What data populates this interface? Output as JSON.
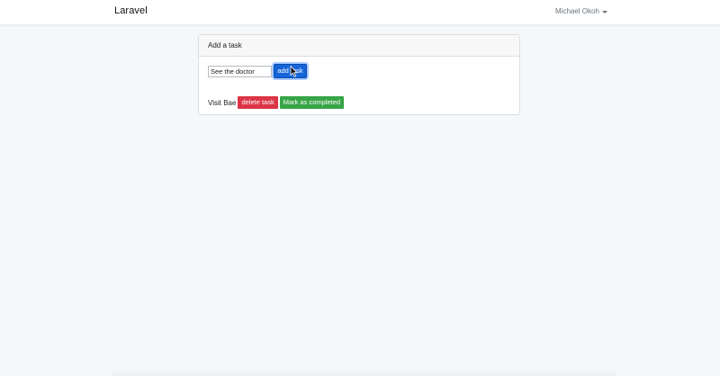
{
  "navbar": {
    "brand": "Laravel",
    "user_name": "Michael Okoh"
  },
  "card": {
    "header": "Add a task",
    "input_value": "See the doctor",
    "add_button_label": "add task"
  },
  "tasks": [
    {
      "text": "Visit Bae",
      "delete_label": "delete task",
      "complete_label": "Mark as completed"
    }
  ],
  "colors": {
    "primary": "#1565d8",
    "danger": "#dc3545",
    "success": "#38a447",
    "background": "#f5f7f9"
  },
  "icons": [
    "caret-down-icon",
    "mouse-cursor-icon"
  ]
}
